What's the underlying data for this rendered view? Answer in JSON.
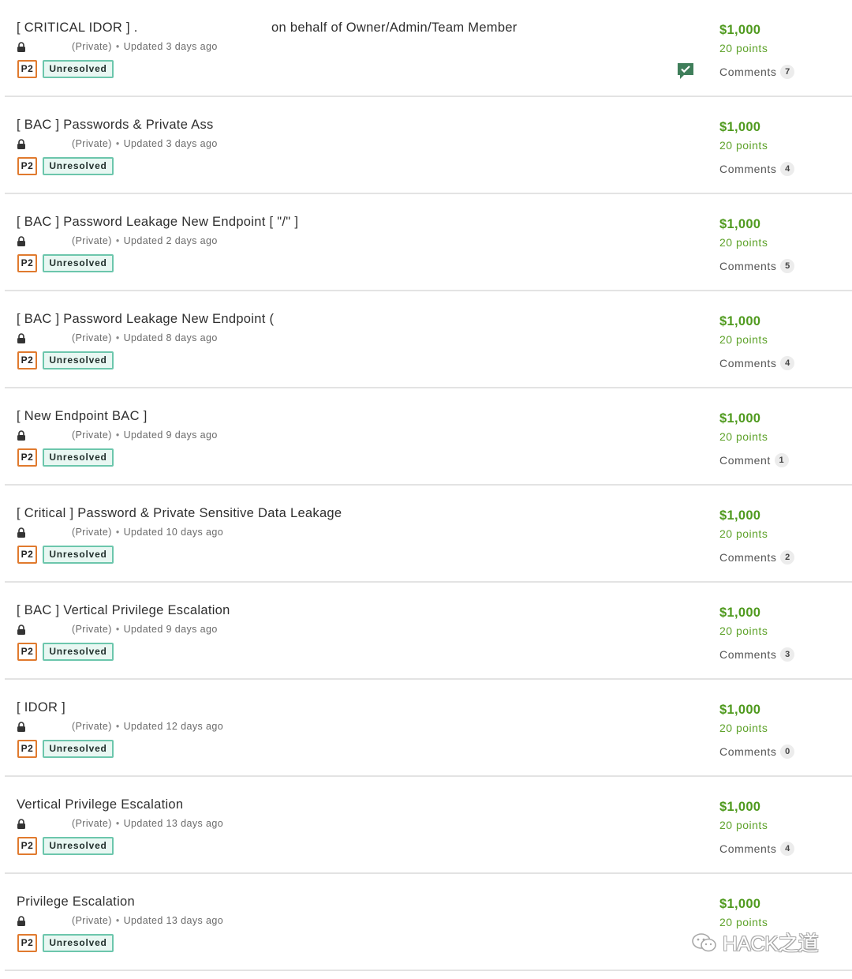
{
  "watermark": "HACK之道",
  "colors": {
    "bounty_green": "#4f9a1e",
    "priority_orange": "#e07a2e",
    "state_teal": "#6cc6ac",
    "flag_green": "#3f7e5a"
  },
  "reports": [
    {
      "title": "[ CRITICAL IDOR ] .",
      "title_extra": "on behalf of Owner/Admin/Team Member",
      "visibility": "(Private)",
      "updated": "Updated 3 days ago",
      "priority": "P2",
      "state": "Unresolved",
      "bounty": "$1,000",
      "points": "20 points",
      "comments_label": "Comments",
      "comments_count": "7",
      "flag_icon": "check-flag-icon"
    },
    {
      "title": "[ BAC ] Passwords & Private Ass",
      "title_extra": "",
      "visibility": "(Private)",
      "updated": "Updated 3 days ago",
      "priority": "P2",
      "state": "Unresolved",
      "bounty": "$1,000",
      "points": "20 points",
      "comments_label": "Comments",
      "comments_count": "4"
    },
    {
      "title": "[ BAC ] Password Leakage New Endpoint [ \"/\" ]",
      "title_extra": "",
      "visibility": "(Private)",
      "updated": "Updated 2 days ago",
      "priority": "P2",
      "state": "Unresolved",
      "bounty": "$1,000",
      "points": "20 points",
      "comments_label": "Comments",
      "comments_count": "5"
    },
    {
      "title": "[ BAC ] Password Leakage New Endpoint (",
      "title_extra": "",
      "visibility": "(Private)",
      "updated": "Updated 8 days ago",
      "priority": "P2",
      "state": "Unresolved",
      "bounty": "$1,000",
      "points": "20 points",
      "comments_label": "Comments",
      "comments_count": "4"
    },
    {
      "title": "[ New Endpoint BAC ]",
      "title_extra": "",
      "visibility": "(Private)",
      "updated": "Updated 9 days ago",
      "priority": "P2",
      "state": "Unresolved",
      "bounty": "$1,000",
      "points": "20 points",
      "comments_label": "Comment",
      "comments_count": "1"
    },
    {
      "title": "[ Critical ] Password & Private Sensitive Data Leakage",
      "title_extra": "",
      "visibility": "(Private)",
      "updated": "Updated 10 days ago",
      "priority": "P2",
      "state": "Unresolved",
      "bounty": "$1,000",
      "points": "20 points",
      "comments_label": "Comments",
      "comments_count": "2"
    },
    {
      "title": "[ BAC ] Vertical Privilege Escalation",
      "title_extra": "",
      "visibility": "(Private)",
      "updated": "Updated 9 days ago",
      "priority": "P2",
      "state": "Unresolved",
      "bounty": "$1,000",
      "points": "20 points",
      "comments_label": "Comments",
      "comments_count": "3"
    },
    {
      "title": "[ IDOR ]",
      "title_extra": "",
      "visibility": "(Private)",
      "updated": "Updated 12 days ago",
      "priority": "P2",
      "state": "Unresolved",
      "bounty": "$1,000",
      "points": "20 points",
      "comments_label": "Comments",
      "comments_count": "0"
    },
    {
      "title": "Vertical Privilege Escalation",
      "title_extra": "",
      "visibility": "(Private)",
      "updated": "Updated 13 days ago",
      "priority": "P2",
      "state": "Unresolved",
      "bounty": "$1,000",
      "points": "20 points",
      "comments_label": "Comments",
      "comments_count": "4"
    },
    {
      "title": "Privilege Escalation",
      "title_extra": "",
      "visibility": "(Private)",
      "updated": "Updated 13 days ago",
      "priority": "P2",
      "state": "Unresolved",
      "bounty": "$1,000",
      "points": "20 points",
      "comments_label": "",
      "comments_count": ""
    }
  ]
}
